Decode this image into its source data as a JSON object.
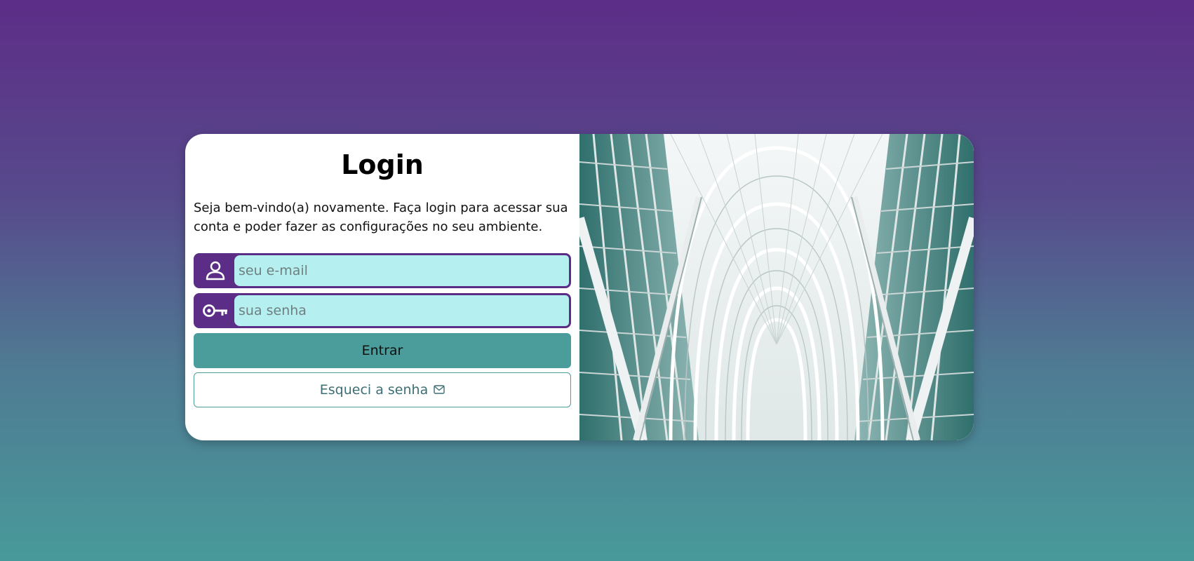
{
  "login": {
    "title": "Login",
    "description": "Seja bem-vindo(a) novamente. Faça login para acessar sua conta e poder fazer as configurações no seu ambiente.",
    "email": {
      "placeholder": "seu e-mail",
      "value": "",
      "icon": "user-icon"
    },
    "password": {
      "placeholder": "sua senha",
      "value": "",
      "icon": "key-icon"
    },
    "submit_label": "Entrar",
    "forgot_label": "Esqueci a senha",
    "forgot_icon": "envelope-icon"
  },
  "colors": {
    "accent_purple": "#5b2d86",
    "input_bg": "#b6efef",
    "teal": "#4a9d9a",
    "bg_top": "#5d2d87",
    "bg_bottom": "#489a9a"
  },
  "image": {
    "subject": "glass-and-steel arched atrium ceiling"
  }
}
